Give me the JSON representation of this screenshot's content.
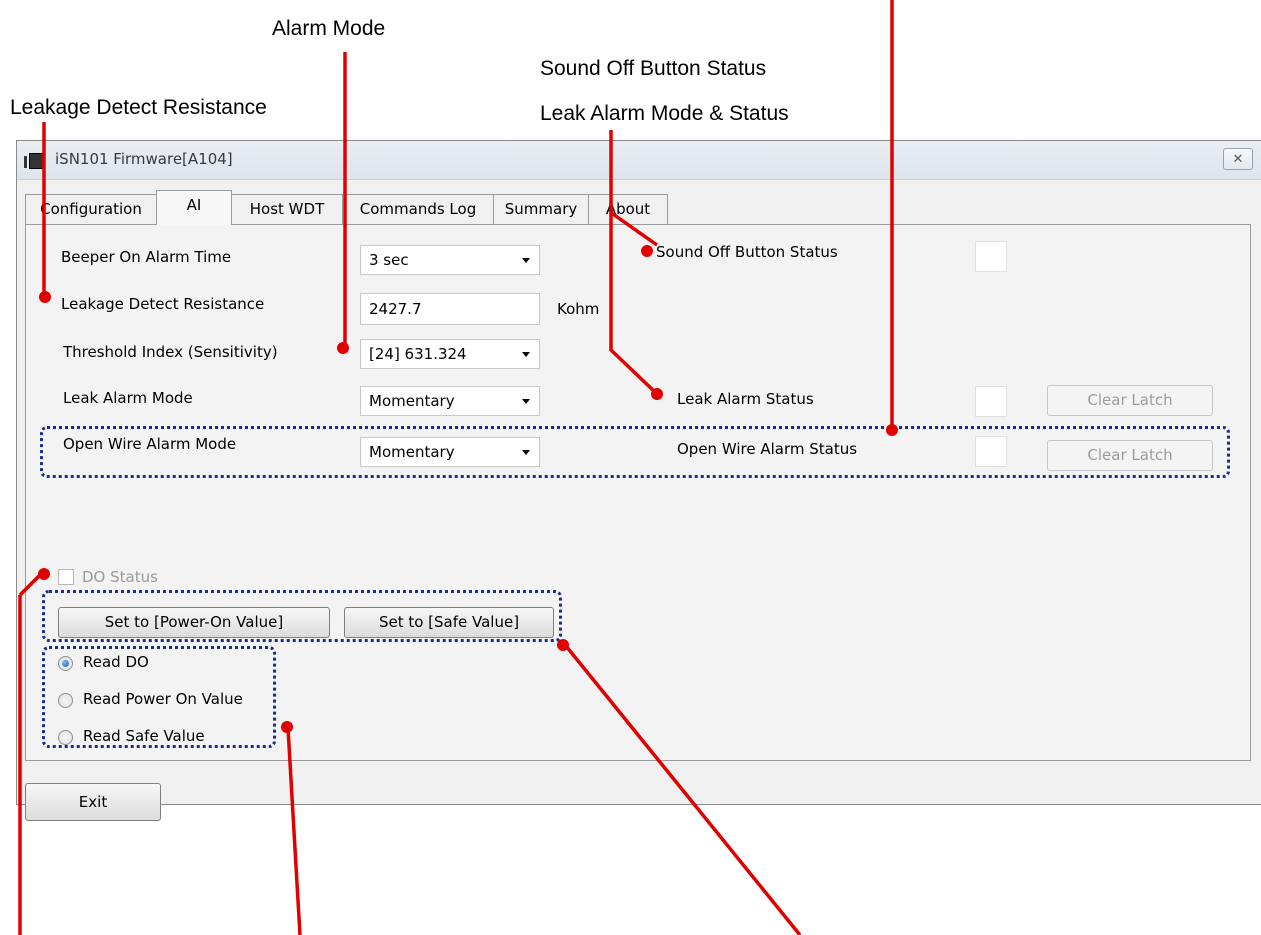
{
  "callouts": {
    "alarm_mode": "Alarm Mode",
    "sound_off_button_status": "Sound Off Button Status",
    "leakage_detect_resistance": "Leakage Detect Resistance",
    "leak_alarm_mode_status": "Leak Alarm Mode & Status"
  },
  "window": {
    "title": "iSN101 Firmware[A104]",
    "close_label": "✕"
  },
  "tabs": [
    {
      "label": "Configuration"
    },
    {
      "label": "AI"
    },
    {
      "label": "Host WDT"
    },
    {
      "label": "Commands Log"
    },
    {
      "label": "Summary"
    },
    {
      "label": "About"
    }
  ],
  "form": {
    "beeper_label": "Beeper On Alarm Time",
    "beeper_value": "3 sec",
    "resistance_label": "Leakage Detect Resistance",
    "resistance_value": "2427.7",
    "resistance_unit": "Kohm",
    "threshold_label": "Threshold Index (Sensitivity)",
    "threshold_value": "[24] 631.324",
    "leak_mode_label": "Leak Alarm Mode",
    "leak_mode_value": "Momentary",
    "open_wire_mode_label": "Open Wire Alarm Mode",
    "open_wire_mode_value": "Momentary",
    "sound_off_label": "Sound Off Button Status",
    "leak_status_label": "Leak Alarm Status",
    "open_wire_status_label": "Open Wire Alarm Status",
    "clear_latch_label": "Clear Latch"
  },
  "do_section": {
    "do_status_label": "DO Status",
    "set_power_on_label": "Set to [Power-On Value]",
    "set_safe_label": "Set to [Safe Value]",
    "radios": [
      {
        "label": "Read DO",
        "selected": true
      },
      {
        "label": "Read Power On Value",
        "selected": false
      },
      {
        "label": "Read Safe Value",
        "selected": false
      }
    ]
  },
  "exit_label": "Exit",
  "colors": {
    "callout_line": "#e00000",
    "dotted_border": "#1c2b8f"
  }
}
